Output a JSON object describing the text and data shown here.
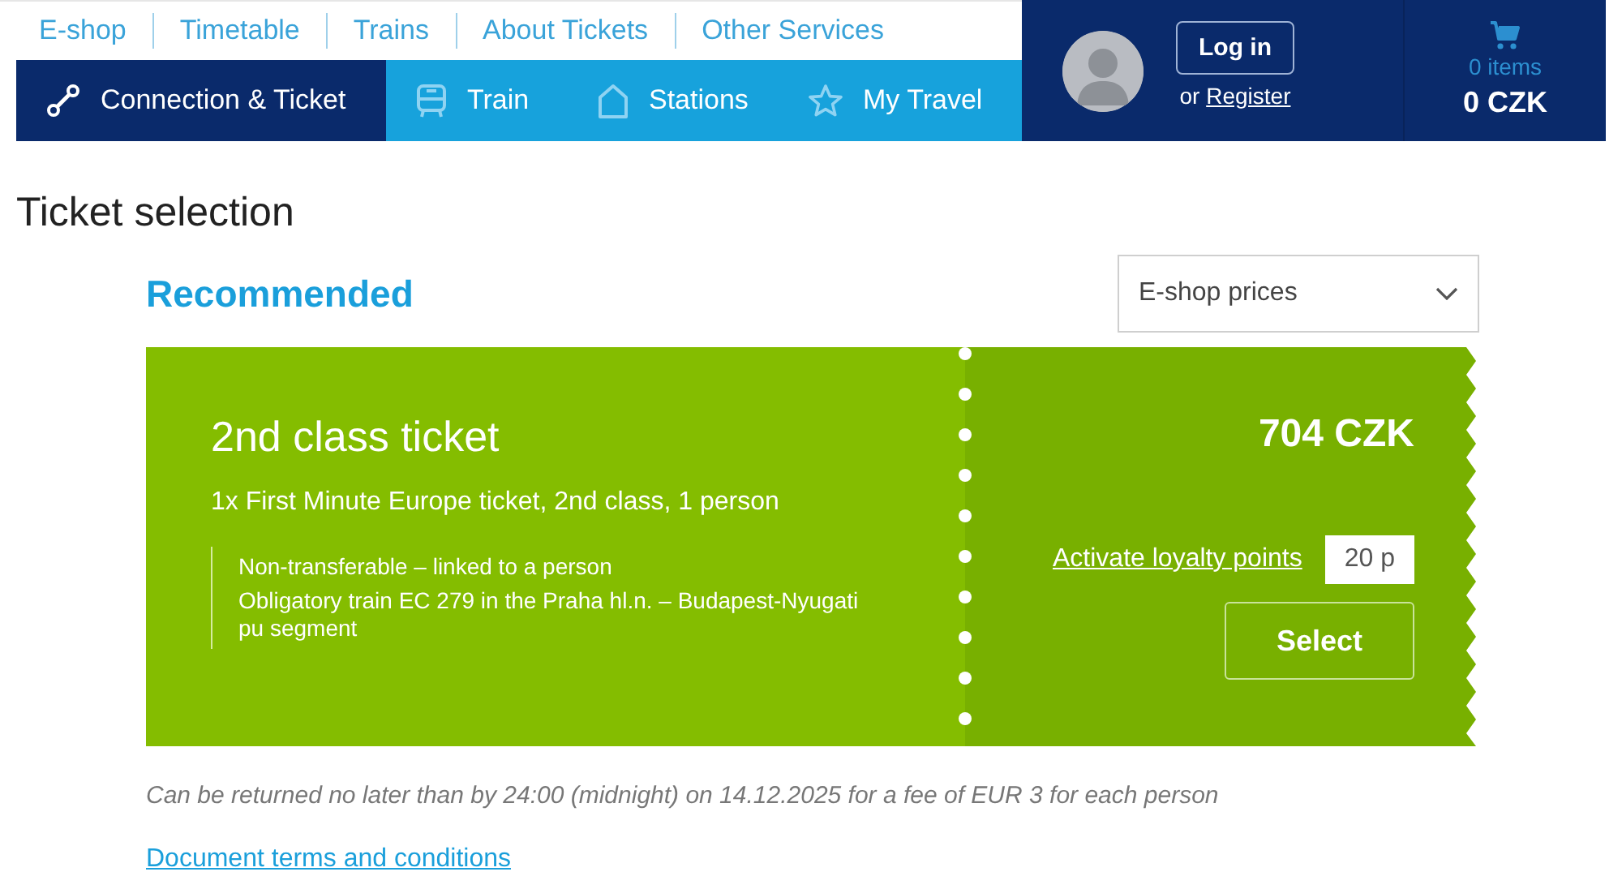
{
  "top_links": [
    "E-shop",
    "Timetable",
    "Trains",
    "About Tickets",
    "Other Services"
  ],
  "nav_tabs": [
    {
      "label": "Connection & Ticket",
      "kind": "route",
      "selected": true
    },
    {
      "label": "Train",
      "kind": "train",
      "selected": false
    },
    {
      "label": "Stations",
      "kind": "station",
      "selected": false
    },
    {
      "label": "My Travel",
      "kind": "star",
      "selected": false
    }
  ],
  "account": {
    "login_button": "Log in",
    "register_prefix": "or",
    "register_link": "Register"
  },
  "cart": {
    "items": "0 items",
    "total": "0 CZK"
  },
  "page_title": "Ticket selection",
  "section_title": "Recommended",
  "price_dropdown": {
    "value": "E-shop prices"
  },
  "ticket": {
    "title": "2nd class ticket",
    "description": "1x First Minute Europe ticket, 2nd class, 1 person",
    "conditions": [
      "Non-transferable – linked to a person",
      "Obligatory train EC 279 in the Praha hl.n. – Budapest-Nyugati pu segment"
    ],
    "price": "704 CZK",
    "loyalty_link": "Activate loyalty points",
    "loyalty_points": "20 p",
    "select_button": "Select"
  },
  "return_note": "Can be returned no later than by 24:00 (midnight) on 14.12.2025 for a fee of EUR 3 for each person",
  "terms_link": "Document terms and conditions"
}
